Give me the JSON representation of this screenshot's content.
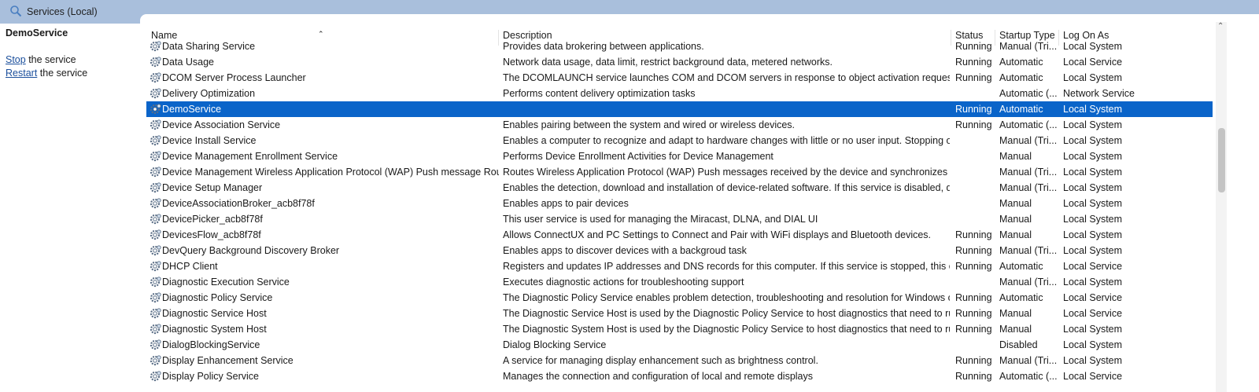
{
  "window": {
    "title": "Services (Local)",
    "title_icon": "magnifier-icon"
  },
  "left_pane": {
    "selected_service": "DemoService",
    "actions": [
      {
        "link": "Stop",
        "text": " the service"
      },
      {
        "link": "Restart",
        "text": " the service"
      }
    ]
  },
  "columns": {
    "name": "Name",
    "description": "Description",
    "status": "Status",
    "startup_type": "Startup Type",
    "log_on_as": "Log On As"
  },
  "colors": {
    "selection": "#0a64c9",
    "title_bar": "#a9bfdc",
    "link": "#1b4f9c"
  },
  "services": [
    {
      "name": "Data Sharing Service",
      "description": "Provides data brokering between applications.",
      "status": "Running",
      "startup": "Manual (Tri...",
      "logon": "Local System"
    },
    {
      "name": "Data Usage",
      "description": "Network data usage, data limit, restrict background data, metered networks.",
      "status": "Running",
      "startup": "Automatic",
      "logon": "Local Service"
    },
    {
      "name": "DCOM Server Process Launcher",
      "description": "The DCOMLAUNCH service launches COM and DCOM servers in response to object activation requests....",
      "status": "Running",
      "startup": "Automatic",
      "logon": "Local System"
    },
    {
      "name": "Delivery Optimization",
      "description": "Performs content delivery optimization tasks",
      "status": "",
      "startup": "Automatic (...",
      "logon": "Network Service"
    },
    {
      "name": "DemoService",
      "description": "",
      "status": "Running",
      "startup": "Automatic",
      "logon": "Local System",
      "selected": true
    },
    {
      "name": "Device Association Service",
      "description": "Enables pairing between the system and wired or wireless devices.",
      "status": "Running",
      "startup": "Automatic (...",
      "logon": "Local System"
    },
    {
      "name": "Device Install Service",
      "description": "Enables a computer to recognize and adapt to hardware changes with little or no user input. Stopping or...",
      "status": "",
      "startup": "Manual (Tri...",
      "logon": "Local System"
    },
    {
      "name": "Device Management Enrollment Service",
      "description": "Performs Device Enrollment Activities for Device Management",
      "status": "",
      "startup": "Manual",
      "logon": "Local System"
    },
    {
      "name": "Device Management Wireless Application Protocol (WAP) Push message Routi...",
      "description": "Routes Wireless Application Protocol (WAP) Push messages received by the device and synchronizes Devi...",
      "status": "",
      "startup": "Manual (Tri...",
      "logon": "Local System"
    },
    {
      "name": "Device Setup Manager",
      "description": "Enables the detection, download and installation of device-related software. If this service is disabled, dev...",
      "status": "",
      "startup": "Manual (Tri...",
      "logon": "Local System"
    },
    {
      "name": "DeviceAssociationBroker_acb8f78f",
      "description": "Enables apps to pair devices",
      "status": "",
      "startup": "Manual",
      "logon": "Local System"
    },
    {
      "name": "DevicePicker_acb8f78f",
      "description": "This user service is used for managing the Miracast, DLNA, and DIAL UI",
      "status": "",
      "startup": "Manual",
      "logon": "Local System"
    },
    {
      "name": "DevicesFlow_acb8f78f",
      "description": "Allows ConnectUX and PC Settings to Connect and Pair with WiFi displays and Bluetooth devices.",
      "status": "Running",
      "startup": "Manual",
      "logon": "Local System"
    },
    {
      "name": "DevQuery Background Discovery Broker",
      "description": "Enables apps to discover devices with a backgroud task",
      "status": "Running",
      "startup": "Manual (Tri...",
      "logon": "Local System"
    },
    {
      "name": "DHCP Client",
      "description": "Registers and updates IP addresses and DNS records for this computer. If this service is stopped, this co...",
      "status": "Running",
      "startup": "Automatic",
      "logon": "Local Service"
    },
    {
      "name": "Diagnostic Execution Service",
      "description": "Executes diagnostic actions for troubleshooting support",
      "status": "",
      "startup": "Manual (Tri...",
      "logon": "Local System"
    },
    {
      "name": "Diagnostic Policy Service",
      "description": "The Diagnostic Policy Service enables problem detection, troubleshooting and resolution for Windows co...",
      "status": "Running",
      "startup": "Automatic",
      "logon": "Local Service"
    },
    {
      "name": "Diagnostic Service Host",
      "description": "The Diagnostic Service Host is used by the Diagnostic Policy Service to host diagnostics that need to run ...",
      "status": "Running",
      "startup": "Manual",
      "logon": "Local Service"
    },
    {
      "name": "Diagnostic System Host",
      "description": "The Diagnostic System Host is used by the Diagnostic Policy Service to host diagnostics that need to run...",
      "status": "Running",
      "startup": "Manual",
      "logon": "Local System"
    },
    {
      "name": "DialogBlockingService",
      "description": "Dialog Blocking Service",
      "status": "",
      "startup": "Disabled",
      "logon": "Local System"
    },
    {
      "name": "Display Enhancement Service",
      "description": "A service for managing display enhancement such as brightness control.",
      "status": "Running",
      "startup": "Manual (Tri...",
      "logon": "Local System"
    },
    {
      "name": "Display Policy Service",
      "description": "Manages the connection and configuration of local and remote displays",
      "status": "Running",
      "startup": "Automatic (...",
      "logon": "Local Service"
    }
  ]
}
